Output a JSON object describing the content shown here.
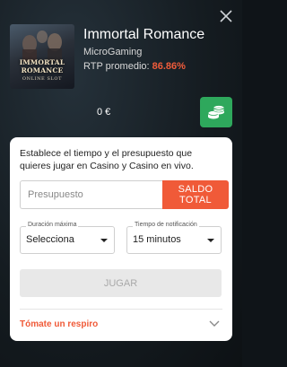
{
  "game": {
    "title": "Immortal Romance",
    "provider": "MicroGaming",
    "rtp_label": "RTP promedio:",
    "rtp_value": "86.86%",
    "thumbnail_title": "IMMORTAL ROMANCE",
    "thumbnail_subtitle": "ONLINE SLOT"
  },
  "wallet": {
    "balance": "0 €"
  },
  "limits_form": {
    "intro": "Establece el tiempo y el presupuesto que quieres jugar en Casino y Casino en vivo.",
    "budget_placeholder": "Presupuesto",
    "total_balance_label": "SALDO TOTAL",
    "max_duration": {
      "label": "Duración máxima",
      "value": "Selecciona"
    },
    "notification_time": {
      "label": "Tiempo de notificación",
      "value": "15 minutos"
    },
    "play_label": "JUGAR",
    "take_break_label": "Tómate un respiro"
  },
  "colors": {
    "accent": "#f05a38",
    "rtp": "#f15c3b",
    "coins_button": "#2ea85c"
  },
  "icons": {
    "close": "close-icon",
    "coins": "coins-icon",
    "chevron": "chevron-down-icon"
  }
}
